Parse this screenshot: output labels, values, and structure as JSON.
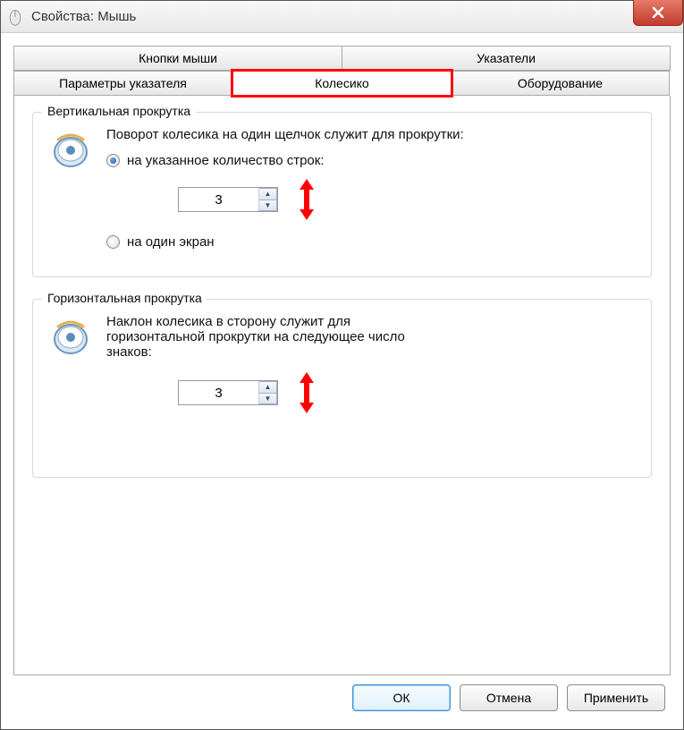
{
  "titlebar": {
    "title": "Свойства: Мышь"
  },
  "tabs": {
    "row1": [
      "Кнопки мыши",
      "Указатели"
    ],
    "row2": [
      "Параметры указателя",
      "Колесико",
      "Оборудование"
    ],
    "active": "Колесико"
  },
  "vertical": {
    "legend": "Вертикальная прокрутка",
    "desc": "Поворот колесика на один щелчок служит для прокрутки:",
    "radio_lines": "на указанное количество строк:",
    "radio_screen": "на один экран",
    "value": "3"
  },
  "horizontal": {
    "legend": "Горизонтальная прокрутка",
    "desc": "Наклон колесика в сторону служит для горизонтальной прокрутки на следующее число знаков:",
    "value": "3"
  },
  "buttons": {
    "ok": "ОК",
    "cancel": "Отмена",
    "apply": "Применить"
  }
}
